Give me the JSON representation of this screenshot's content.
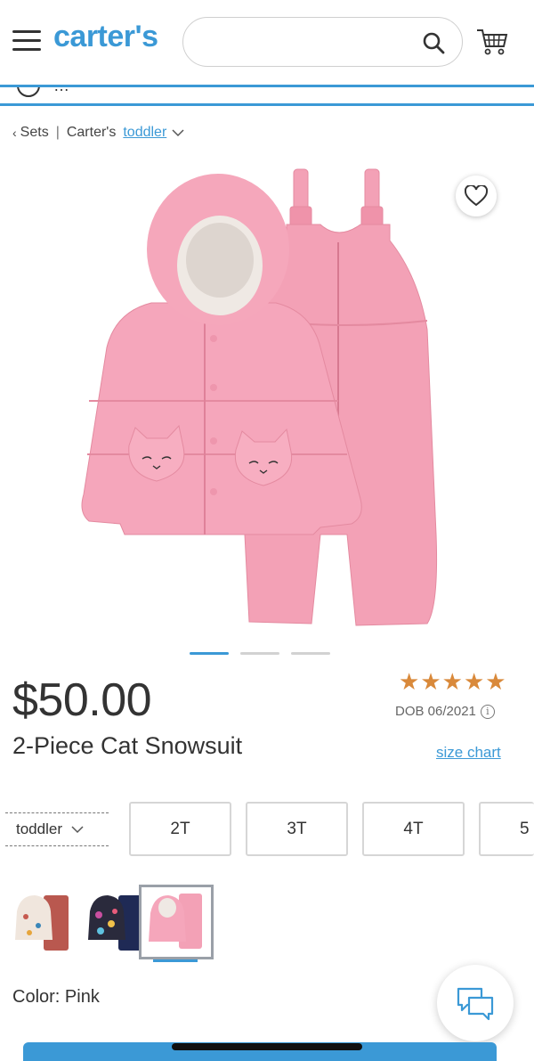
{
  "header": {
    "logo_text": "carter's",
    "search": {
      "value": "",
      "placeholder": ""
    },
    "icons": [
      "menu-icon",
      "search-icon",
      "cart-icon"
    ]
  },
  "promo": {
    "text": "…"
  },
  "breadcrumb": {
    "back_label": "Sets",
    "separator": "|",
    "brand": "Carter's",
    "size_link": "toddler"
  },
  "product": {
    "price": "$50.00",
    "rating_stars": 5,
    "dob": "DOB 06/2021",
    "title": "2-Piece Cat Snowsuit",
    "size_chart_label": "size chart",
    "image_count": 3,
    "active_image_index": 0,
    "size_type": "toddler",
    "sizes": [
      "2T",
      "3T",
      "4T",
      "5"
    ],
    "swatches": [
      "cream-print",
      "dark-floral",
      "pink"
    ],
    "selected_swatch_index": 2,
    "color_label": "Color: Pink"
  },
  "colors": {
    "accent": "#3b99d6",
    "star": "#d9893a",
    "pink": "#f4a3b8"
  }
}
